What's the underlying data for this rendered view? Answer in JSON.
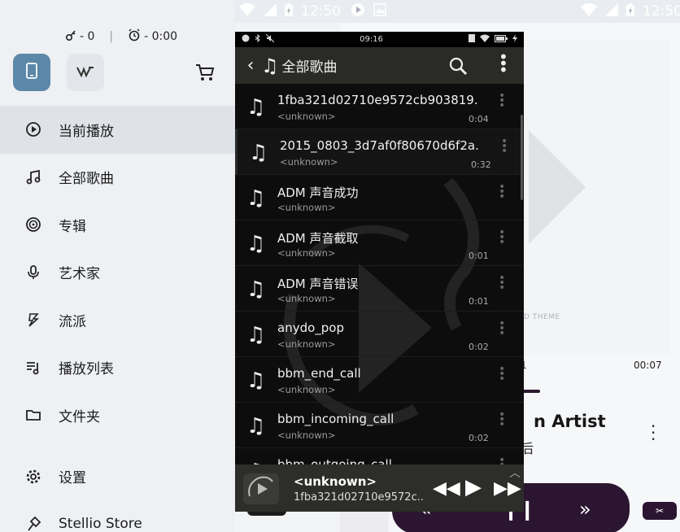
{
  "status_right": {
    "time": "12:50"
  },
  "status_mid": {
    "time": "12:50"
  },
  "drawer": {
    "counter_left": "- 0",
    "counter_right": "- 0:00",
    "menu": [
      {
        "label": "当前播放",
        "icon": "play-circle-icon"
      },
      {
        "label": "全部歌曲",
        "icon": "music-note-icon"
      },
      {
        "label": "专辑",
        "icon": "album-icon"
      },
      {
        "label": "艺术家",
        "icon": "microphone-icon"
      },
      {
        "label": "流派",
        "icon": "genre-icon"
      },
      {
        "label": "播放列表",
        "icon": "playlist-icon"
      },
      {
        "label": "文件夹",
        "icon": "folder-icon"
      },
      {
        "label": "设置",
        "icon": "gear-icon"
      },
      {
        "label": "Stellio Store",
        "icon": "store-icon"
      }
    ]
  },
  "app": {
    "status_time": "09:16",
    "title": "全部歌曲",
    "songs": [
      {
        "title": "1fba321d02710e9572cb903819..",
        "artist": "<unknown>",
        "duration": "0:04"
      },
      {
        "title": "2015_0803_3d7af0f80670d6f2a..",
        "artist": "<unknown>",
        "duration": "0:32"
      },
      {
        "title": "ADM 声音成功",
        "artist": "<unknown>",
        "duration": ""
      },
      {
        "title": "ADM 声音截取",
        "artist": "<unknown>",
        "duration": "0:01"
      },
      {
        "title": "ADM 声音错误",
        "artist": "<unknown>",
        "duration": "0:01"
      },
      {
        "title": "anydo_pop",
        "artist": "<unknown>",
        "duration": "0:02"
      },
      {
        "title": "bbm_end_call",
        "artist": "<unknown>",
        "duration": ""
      },
      {
        "title": "bbm_incoming_call",
        "artist": "<unknown>",
        "duration": "0:02"
      },
      {
        "title": "bbm_outgoing_call",
        "artist": "",
        "duration": ""
      }
    ],
    "now_playing": {
      "artist": "<unknown>",
      "title": "1fba321d02710e9572c.."
    }
  },
  "background": {
    "theme_text": "D THEME",
    "time_left": "1",
    "time_right": "00:07",
    "artist": "n Artist",
    "sub": "后"
  }
}
